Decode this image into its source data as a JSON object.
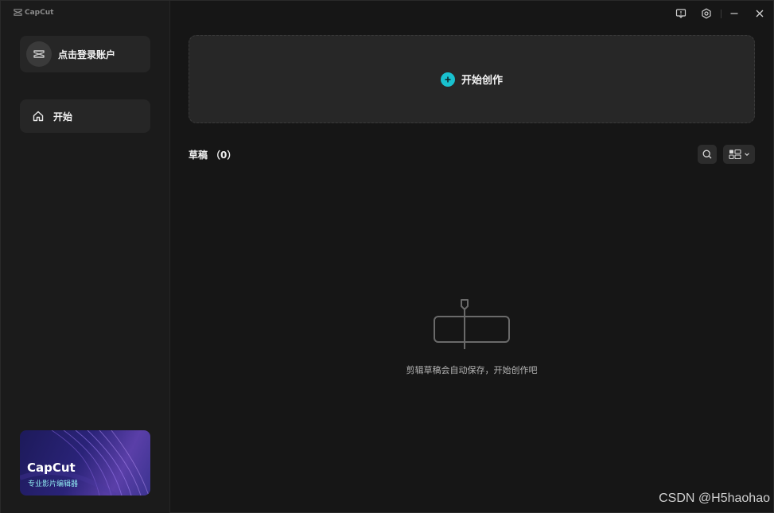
{
  "brand": {
    "name": "CapCut"
  },
  "sidebar": {
    "login_label": "点击登录账户",
    "nav": [
      {
        "label": "开始",
        "icon": "home-icon"
      }
    ],
    "promo": {
      "title": "CapCut",
      "subtitle": "专业影片编辑器"
    }
  },
  "titlebar": {
    "icons": [
      "feedback-icon",
      "settings-icon",
      "minimize-icon",
      "close-icon"
    ]
  },
  "main": {
    "create_label": "开始创作",
    "drafts_title": "草稿",
    "drafts_count": "（0）",
    "empty_text": "剪辑草稿会自动保存，开始创作吧"
  },
  "watermark": "CSDN @H5haohao",
  "colors": {
    "accent": "#19c1cf",
    "background": "#161616",
    "sidebar": "#1b1b1b",
    "card": "#262626"
  }
}
